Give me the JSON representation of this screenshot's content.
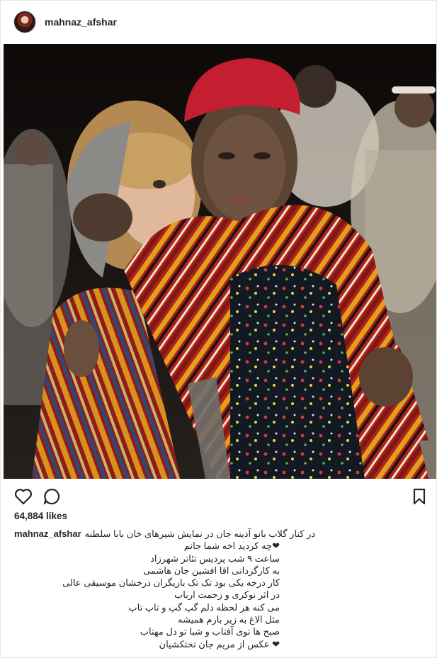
{
  "post": {
    "username": "mahnaz_afshar",
    "likes": "64,884 likes",
    "caption_user": "mahnaz_afshar",
    "caption_lines": [
      "در کنار گلاب بانو آدینه جان در نمایش شیرهای خان بابا سلطنه",
      "❤چه کردید اخه شما جانم",
      "ساعت ۹ شب پردیس تئاتر شهرزاد",
      "به کارگردانی اقا افشین جان هاشمی",
      "کار درجه یکی بود تک تک بازیگران درخشان موسیقی عالی",
      "در اثر نوکری و زحمت ارباب",
      "می کنه هر لحظه دلم گپ گپ و تاپ تاپ",
      "مثل الاغ به زیر بارم همیشه",
      "صبح ها توی آفتاب و شبا تو دل مهتاب",
      "❤ عکس از مریم جان تختکشیان"
    ]
  },
  "icons": {
    "avatar": "profile-avatar",
    "like": "heart-icon",
    "comment": "comment-icon",
    "save": "bookmark-icon"
  },
  "photo": {
    "subject": "two actors embracing on stage in colorful striped costumes"
  }
}
